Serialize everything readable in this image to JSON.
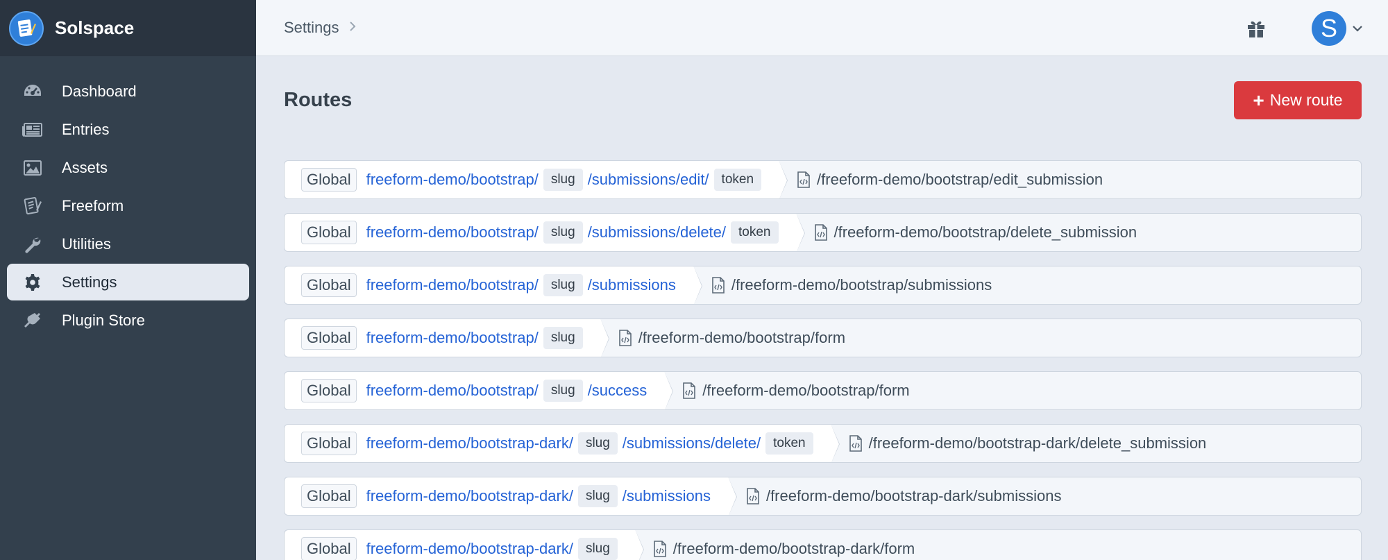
{
  "brand": {
    "name": "Solspace",
    "logo_icon": "document-pencil-icon",
    "accent": "#2f7fd9"
  },
  "sidebar": {
    "items": [
      {
        "label": "Dashboard",
        "icon": "gauge-icon",
        "active": false
      },
      {
        "label": "Entries",
        "icon": "newspaper-icon",
        "active": false
      },
      {
        "label": "Assets",
        "icon": "image-icon",
        "active": false
      },
      {
        "label": "Freeform",
        "icon": "freeform-icon",
        "active": false
      },
      {
        "label": "Utilities",
        "icon": "wrench-icon",
        "active": false
      },
      {
        "label": "Settings",
        "icon": "gear-icon",
        "active": true
      },
      {
        "label": "Plugin Store",
        "icon": "plug-icon",
        "active": false
      }
    ]
  },
  "header": {
    "breadcrumb": "Settings",
    "gift_icon": "gift-icon",
    "avatar_letter": "S"
  },
  "main": {
    "title": "Routes",
    "new_route_label": "New route",
    "new_route_color": "#da3a3e"
  },
  "routes": [
    {
      "site": "Global",
      "segments": [
        {
          "type": "text",
          "value": "freeform-demo/bootstrap/"
        },
        {
          "type": "token",
          "value": "slug"
        },
        {
          "type": "text",
          "value": "/submissions/edit/"
        },
        {
          "type": "token",
          "value": "token"
        }
      ],
      "template": "/freeform-demo/bootstrap/edit_submission"
    },
    {
      "site": "Global",
      "segments": [
        {
          "type": "text",
          "value": "freeform-demo/bootstrap/"
        },
        {
          "type": "token",
          "value": "slug"
        },
        {
          "type": "text",
          "value": "/submissions/delete/"
        },
        {
          "type": "token",
          "value": "token"
        }
      ],
      "template": "/freeform-demo/bootstrap/delete_submission"
    },
    {
      "site": "Global",
      "segments": [
        {
          "type": "text",
          "value": "freeform-demo/bootstrap/"
        },
        {
          "type": "token",
          "value": "slug"
        },
        {
          "type": "text",
          "value": "/submissions"
        }
      ],
      "template": "/freeform-demo/bootstrap/submissions"
    },
    {
      "site": "Global",
      "segments": [
        {
          "type": "text",
          "value": "freeform-demo/bootstrap/"
        },
        {
          "type": "token",
          "value": "slug"
        }
      ],
      "template": "/freeform-demo/bootstrap/form"
    },
    {
      "site": "Global",
      "segments": [
        {
          "type": "text",
          "value": "freeform-demo/bootstrap/"
        },
        {
          "type": "token",
          "value": "slug"
        },
        {
          "type": "text",
          "value": "/success"
        }
      ],
      "template": "/freeform-demo/bootstrap/form"
    },
    {
      "site": "Global",
      "segments": [
        {
          "type": "text",
          "value": "freeform-demo/bootstrap-dark/"
        },
        {
          "type": "token",
          "value": "slug"
        },
        {
          "type": "text",
          "value": "/submissions/delete/"
        },
        {
          "type": "token",
          "value": "token"
        }
      ],
      "template": "/freeform-demo/bootstrap-dark/delete_submission"
    },
    {
      "site": "Global",
      "segments": [
        {
          "type": "text",
          "value": "freeform-demo/bootstrap-dark/"
        },
        {
          "type": "token",
          "value": "slug"
        },
        {
          "type": "text",
          "value": "/submissions"
        }
      ],
      "template": "/freeform-demo/bootstrap-dark/submissions"
    },
    {
      "site": "Global",
      "segments": [
        {
          "type": "text",
          "value": "freeform-demo/bootstrap-dark/"
        },
        {
          "type": "token",
          "value": "slug"
        }
      ],
      "template": "/freeform-demo/bootstrap-dark/form"
    }
  ]
}
